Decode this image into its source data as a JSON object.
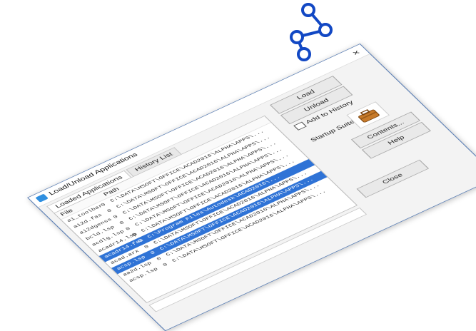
{
  "window": {
    "title": "Load/Unload Applications",
    "close_glyph": "×"
  },
  "tabs": [
    {
      "label": "Loaded Applications",
      "active": true
    },
    {
      "label": "History List",
      "active": false
    }
  ],
  "table": {
    "headers": {
      "file": "File",
      "path": "Path"
    },
    "rows": [
      {
        "file": "ai_toolbar",
        "num": "0",
        "path": "C:\\DATA\\MSOFT\\OFFICE\\ACAD2016\\ALPHA\\APPS\\...",
        "selected": false
      },
      {
        "file": "ai2d.fas",
        "num": "0",
        "path": "C:\\DATA\\MSOFT\\OFFICE\\ACAD2016\\ALPHA\\APPS\\...",
        "selected": false
      },
      {
        "file": "ai2dgenss",
        "num": "0",
        "path": "C:\\DATA\\MSOFT\\OFFICE\\ACAD2016\\ALPHA\\APPS\\...",
        "selected": false
      },
      {
        "file": "bcld.lsp",
        "num": "0",
        "path": "C:\\DATA\\MSOFT\\OFFICE\\ACAD2016\\ALPHA\\APPS\\...",
        "selected": false
      },
      {
        "file": "acdlg.lsp",
        "num": "0",
        "path": "C:\\DATA\\MSOFT\\OFFICE\\ACAD2016\\ALPHA\\APPS\\...",
        "selected": false
      },
      {
        "file": "acadr14.lsp",
        "num": "0",
        "path": "C:\\DATA\\MSOFT\\OFFICE\\ACAD2016\\ALPHA\\APPS\\...",
        "selected": false
      },
      {
        "file": "acadr14.fas",
        "num": "0",
        "path": "C:\\Program Files\\Autodesk\\ACAD2016\\...",
        "selected": true
      },
      {
        "file": "acad.arx",
        "num": "0",
        "path": "C:\\DATA\\MSOFT\\OFFICE\\ACAD2016\\ALPHA\\APPS\\...",
        "selected": false
      },
      {
        "file": "acsp.lsp",
        "num": "0",
        "path": "C:\\DATA\\MSOFT\\OFFICE\\ACAD2016\\ALPHA\\APPS\\...",
        "selected": true
      },
      {
        "file": "aa2d.lsp",
        "num": "0",
        "path": "C:\\DATA\\MSOFT\\OFFICE\\ACAD2016\\ALPHA\\APPS\\...",
        "selected": false
      },
      {
        "file": "acsp.lsp",
        "num": "0",
        "path": "C:\\DATA\\MSOFT\\OFFICE\\ACAD2016\\ALPHA\\APPS\\...",
        "selected": false
      }
    ]
  },
  "buttons": {
    "load": "Load",
    "unload": "Unload",
    "contents": "Contents...",
    "help": "Help",
    "close": "Close"
  },
  "add_to_history": {
    "label": "Add to History",
    "checked": false
  },
  "startup_suite": {
    "label": "Startup Suite",
    "icon": "briefcase-icon"
  },
  "colors": {
    "accent": "#2f73d6",
    "connector": "#1248c4"
  },
  "decoration": {
    "icon": "share-nodes-icon"
  }
}
